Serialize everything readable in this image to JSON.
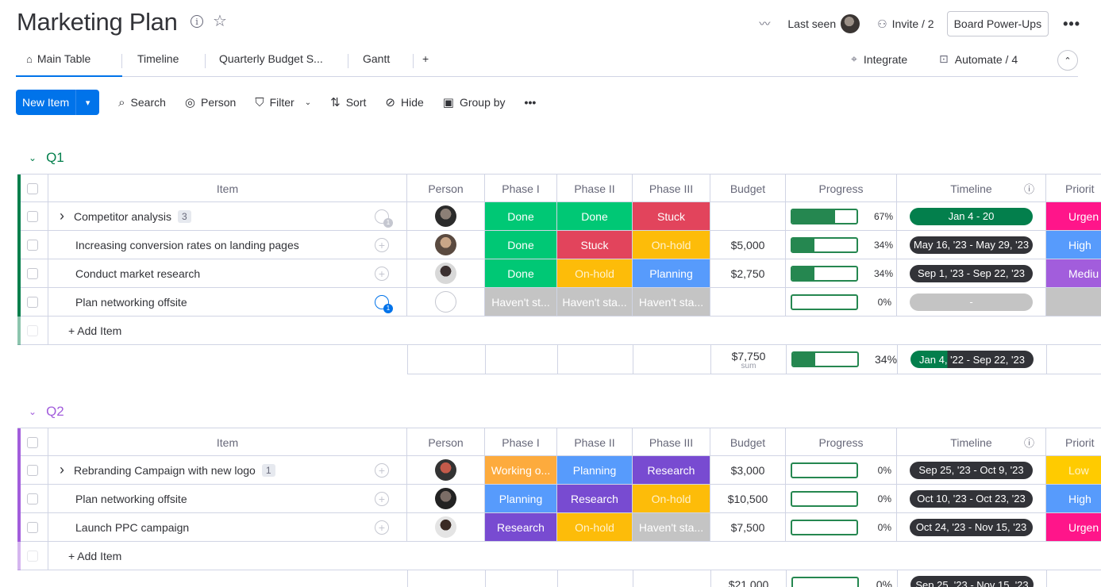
{
  "colors": {
    "q1": "#037f4c",
    "q2": "#a25ddc",
    "done": "#00c875",
    "stuck": "#e2445c",
    "onhold": "#fdbc09",
    "planning": "#579bfc",
    "research": "#784bd1",
    "working": "#fdab3d",
    "not_started": "#c4c4c4",
    "urgent": "#ff158a",
    "high": "#579bfc",
    "medium": "#a25ddc",
    "low": "#ffcb00",
    "accent": "#0073ea"
  },
  "header": {
    "title": "Marketing Plan",
    "info_icon": "info-icon",
    "star_icon": "star-icon",
    "activity_icon": "activity-icon",
    "last_seen": "Last seen",
    "invite": "Invite / 2",
    "power_ups": "Board Power-Ups",
    "more": "•••"
  },
  "tabs": {
    "items": [
      "Main Table",
      "Timeline",
      "Quarterly Budget S...",
      "Gantt"
    ],
    "add": "+",
    "integrate": "Integrate",
    "automate": "Automate / 4",
    "collapse": "⌃"
  },
  "toolbar": {
    "new_item": "New Item",
    "search": "Search",
    "person": "Person",
    "filter": "Filter",
    "sort": "Sort",
    "hide": "Hide",
    "group_by": "Group by",
    "more": "•••"
  },
  "columns": [
    "Item",
    "Person",
    "Phase I",
    "Phase II",
    "Phase III",
    "Budget",
    "Progress",
    "Timeline",
    "Priority"
  ],
  "priority_header_visible": "Priorit",
  "groups": [
    {
      "name": "Q1",
      "rows": [
        {
          "item": "Competitor analysis",
          "subitems": "3",
          "phase1": "Done",
          "phase2": "Done",
          "phase3": "Stuck",
          "budget": "",
          "progress": 67,
          "progress_label": "67%",
          "timeline": "Jan 4 - 20",
          "priority": "Urgent",
          "priority_visible": "Urgen"
        },
        {
          "item": "Increasing conversion rates on landing pages",
          "subitems": "",
          "phase1": "Done",
          "phase2": "Stuck",
          "phase3": "On-hold",
          "budget": "$5,000",
          "progress": 34,
          "progress_label": "34%",
          "timeline": "May 16, '23 - May 29, '23",
          "priority": "High",
          "priority_visible": "High"
        },
        {
          "item": "Conduct market research",
          "subitems": "",
          "phase1": "Done",
          "phase2": "On-hold",
          "phase3": "Planning",
          "budget": "$2,750",
          "progress": 34,
          "progress_label": "34%",
          "timeline": "Sep 1, '23 - Sep 22, '23",
          "priority": "Medium",
          "priority_visible": "Mediu"
        },
        {
          "item": "Plan networking offsite",
          "subitems": "",
          "phase1": "Haven't st...",
          "phase2": "Haven't sta...",
          "phase3": "Haven't sta...",
          "budget": "",
          "progress": 0,
          "progress_label": "0%",
          "timeline": "-",
          "priority": "",
          "priority_visible": ""
        }
      ],
      "add_item": "+ Add Item",
      "summary": {
        "budget": "$7,750",
        "budget_sub": "sum",
        "progress": 34,
        "progress_label": "34%",
        "timeline": "Jan 4, '22 - Sep 22, '23"
      }
    },
    {
      "name": "Q2",
      "rows": [
        {
          "item": "Rebranding Campaign with new logo",
          "subitems": "1",
          "phase1": "Working o...",
          "phase2": "Planning",
          "phase3": "Research",
          "budget": "$3,000",
          "progress": 0,
          "progress_label": "0%",
          "timeline": "Sep 25, '23 - Oct 9, '23",
          "priority": "Low",
          "priority_visible": "Low"
        },
        {
          "item": "Plan networking offsite",
          "subitems": "",
          "phase1": "Planning",
          "phase2": "Research",
          "phase3": "On-hold",
          "budget": "$10,500",
          "progress": 0,
          "progress_label": "0%",
          "timeline": "Oct 10, '23 - Oct 23, '23",
          "priority": "High",
          "priority_visible": "High"
        },
        {
          "item": "Launch PPC campaign",
          "subitems": "",
          "phase1": "Research",
          "phase2": "On-hold",
          "phase3": "Haven't sta...",
          "budget": "$7,500",
          "progress": 0,
          "progress_label": "0%",
          "timeline": "Oct 24, '23 - Nov 15, '23",
          "priority": "Urgent",
          "priority_visible": "Urgen"
        }
      ],
      "add_item": "+ Add Item",
      "summary": {
        "budget": "$21,000",
        "budget_sub": "",
        "progress": 0,
        "progress_label": "0%",
        "timeline": "Sep 25, '23 - Nov 15, '23"
      }
    }
  ]
}
